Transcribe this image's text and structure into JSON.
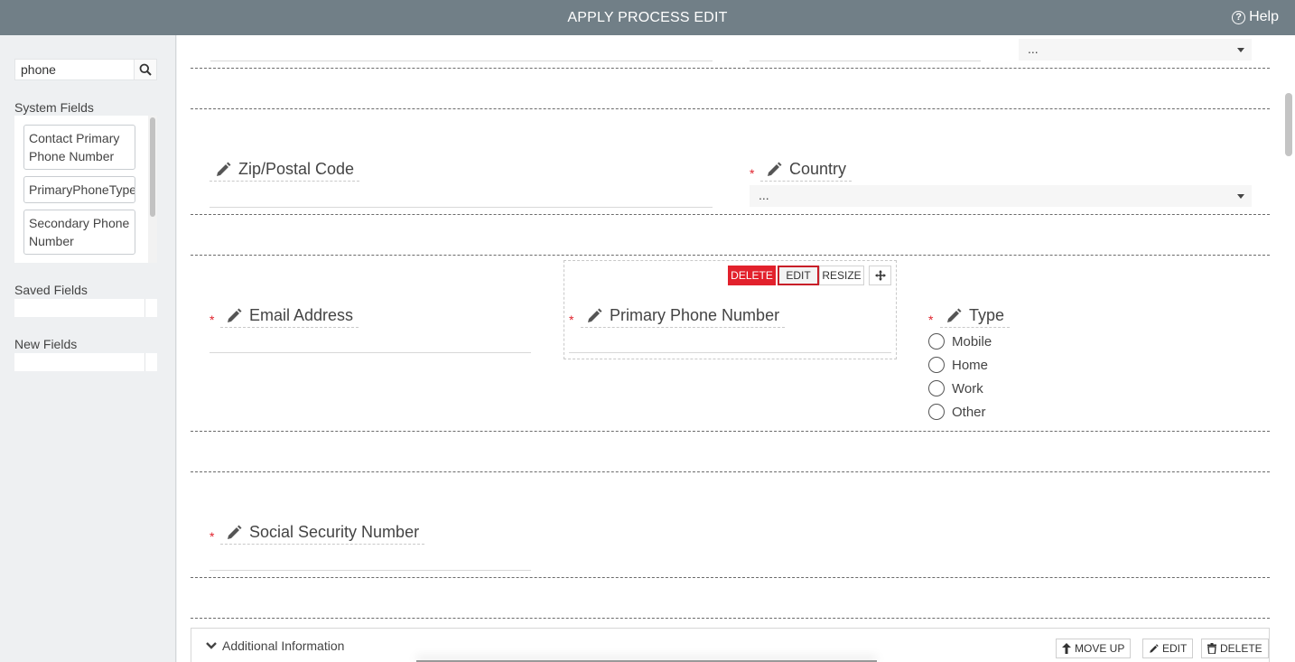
{
  "titlebar": {
    "title": "APPLY PROCESS EDIT",
    "help_label": "Help"
  },
  "sidebar": {
    "search_value": "phone",
    "system_fields_label": "System Fields",
    "system_fields": [
      "Contact Primary Phone Number",
      "PrimaryPhoneType",
      "Secondary Phone Number"
    ],
    "saved_fields_label": "Saved Fields",
    "new_fields_label": "New Fields"
  },
  "form": {
    "top_select_value": "...",
    "zip_label": "Zip/Postal Code",
    "country_label": "Country",
    "country_value": "...",
    "email_label": "Email Address",
    "phone_label": "Primary Phone Number",
    "type_label": "Type",
    "type_options": [
      "Mobile",
      "Home",
      "Work",
      "Other"
    ],
    "ssn_label": "Social Security Number",
    "required_mark": "*"
  },
  "toolbar": {
    "delete": "DELETE",
    "edit": "EDIT",
    "resize": "RESIZE"
  },
  "section": {
    "title": "Additional Information",
    "move_up": "MOVE UP",
    "edit": "EDIT",
    "delete": "DELETE"
  },
  "colors": {
    "header": "#717f87",
    "danger": "#e2212c",
    "required": "#e0232d"
  }
}
